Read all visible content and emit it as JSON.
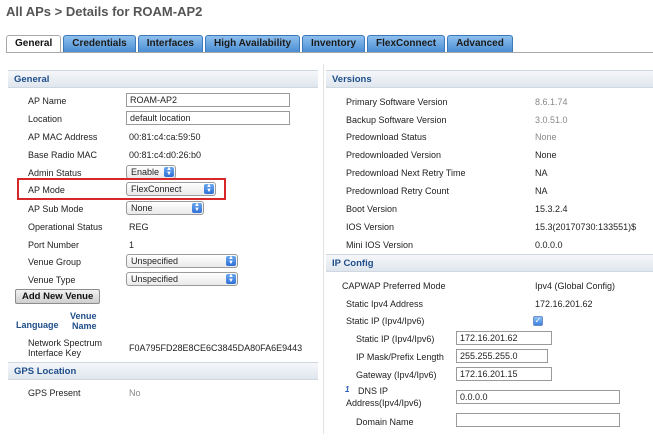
{
  "breadcrumb": "All APs > Details for ROAM-AP2",
  "tabs": [
    {
      "label": "General",
      "active": true
    },
    {
      "label": "Credentials"
    },
    {
      "label": "Interfaces"
    },
    {
      "label": "High Availability"
    },
    {
      "label": "Inventory"
    },
    {
      "label": "FlexConnect"
    },
    {
      "label": "Advanced"
    }
  ],
  "general": {
    "heading": "General",
    "ap_name_label": "AP Name",
    "ap_name_value": "ROAM-AP2",
    "location_label": "Location",
    "location_value": "default location",
    "ap_mac_label": "AP MAC Address",
    "ap_mac_value": "00:81:c4:ca:59:50",
    "base_radio_mac_label": "Base Radio MAC",
    "base_radio_mac_value": "00:81:c4:d0:26:b0",
    "admin_status_label": "Admin Status",
    "admin_status_value": "Enable",
    "ap_mode_label": "AP Mode",
    "ap_mode_value": "FlexConnect",
    "ap_sub_mode_label": "AP Sub Mode",
    "ap_sub_mode_value": "None",
    "operational_status_label": "Operational Status",
    "operational_status_value": "REG",
    "port_number_label": "Port Number",
    "port_number_value": "1",
    "venue_group_label": "Venue Group",
    "venue_group_value": "Unspecified",
    "venue_type_label": "Venue Type",
    "venue_type_value": "Unspecified",
    "add_new_venue_label": "Add New Venue",
    "language_header": "Language",
    "venue_name_header_1": "Venue",
    "venue_name_header_2": "Name",
    "network_spectrum_label_1": "Network Spectrum",
    "network_spectrum_label_2": "Interface Key",
    "network_spectrum_value": "F0A795FD28E8CE6C3845DA80FA6E9443"
  },
  "gps": {
    "heading": "GPS Location",
    "gps_present_label": "GPS Present",
    "gps_present_value": "No"
  },
  "versions": {
    "heading": "Versions",
    "rows": [
      {
        "label": "Primary Software Version",
        "value": "8.6.1.74",
        "grey": true
      },
      {
        "label": "Backup Software Version",
        "value": "3.0.51.0",
        "grey": true
      },
      {
        "label": "Predownload Status",
        "value": "None",
        "grey": true
      },
      {
        "label": "Predownloaded Version",
        "value": "None"
      },
      {
        "label": "Predownload Next Retry Time",
        "value": "NA"
      },
      {
        "label": "Predownload Retry Count",
        "value": "NA"
      },
      {
        "label": "Boot Version",
        "value": "15.3.2.4"
      },
      {
        "label": "IOS Version",
        "value": "15.3(20170730:133551)$"
      },
      {
        "label": "Mini IOS Version",
        "value": "0.0.0.0"
      }
    ]
  },
  "ip_config": {
    "heading": "IP Config",
    "capwap_label": "CAPWAP Preferred Mode",
    "capwap_value": "Ipv4 (Global Config)",
    "static_ipv4_label": "Static Ipv4 Address",
    "static_ipv4_value": "172.16.201.62",
    "static_ip_toggle_label": "Static IP (Ipv4/Ipv6)",
    "static_ip_checked": "✓",
    "static_ip_label": "Static IP (Ipv4/Ipv6)",
    "static_ip_value": "172.16.201.62",
    "mask_label": "IP Mask/Prefix Length",
    "mask_value": "255.255.255.0",
    "gateway_label": "Gateway (Ipv4/Ipv6)",
    "gateway_value": "172.16.201.15",
    "dns_marker": "1",
    "dns_label_1": "DNS IP",
    "dns_label_2": "Address(Ipv4/Ipv6)",
    "dns_value": "0.0.0.0",
    "domain_label": "Domain Name",
    "domain_value": ""
  },
  "colors": {
    "highlight": "#d62828",
    "tab_blue": "#4b8ed3",
    "section_heading": "#1f4e8a"
  },
  "icons": {
    "select_arrow": "select-arrow-icon",
    "checkbox": "checkmark-icon"
  }
}
